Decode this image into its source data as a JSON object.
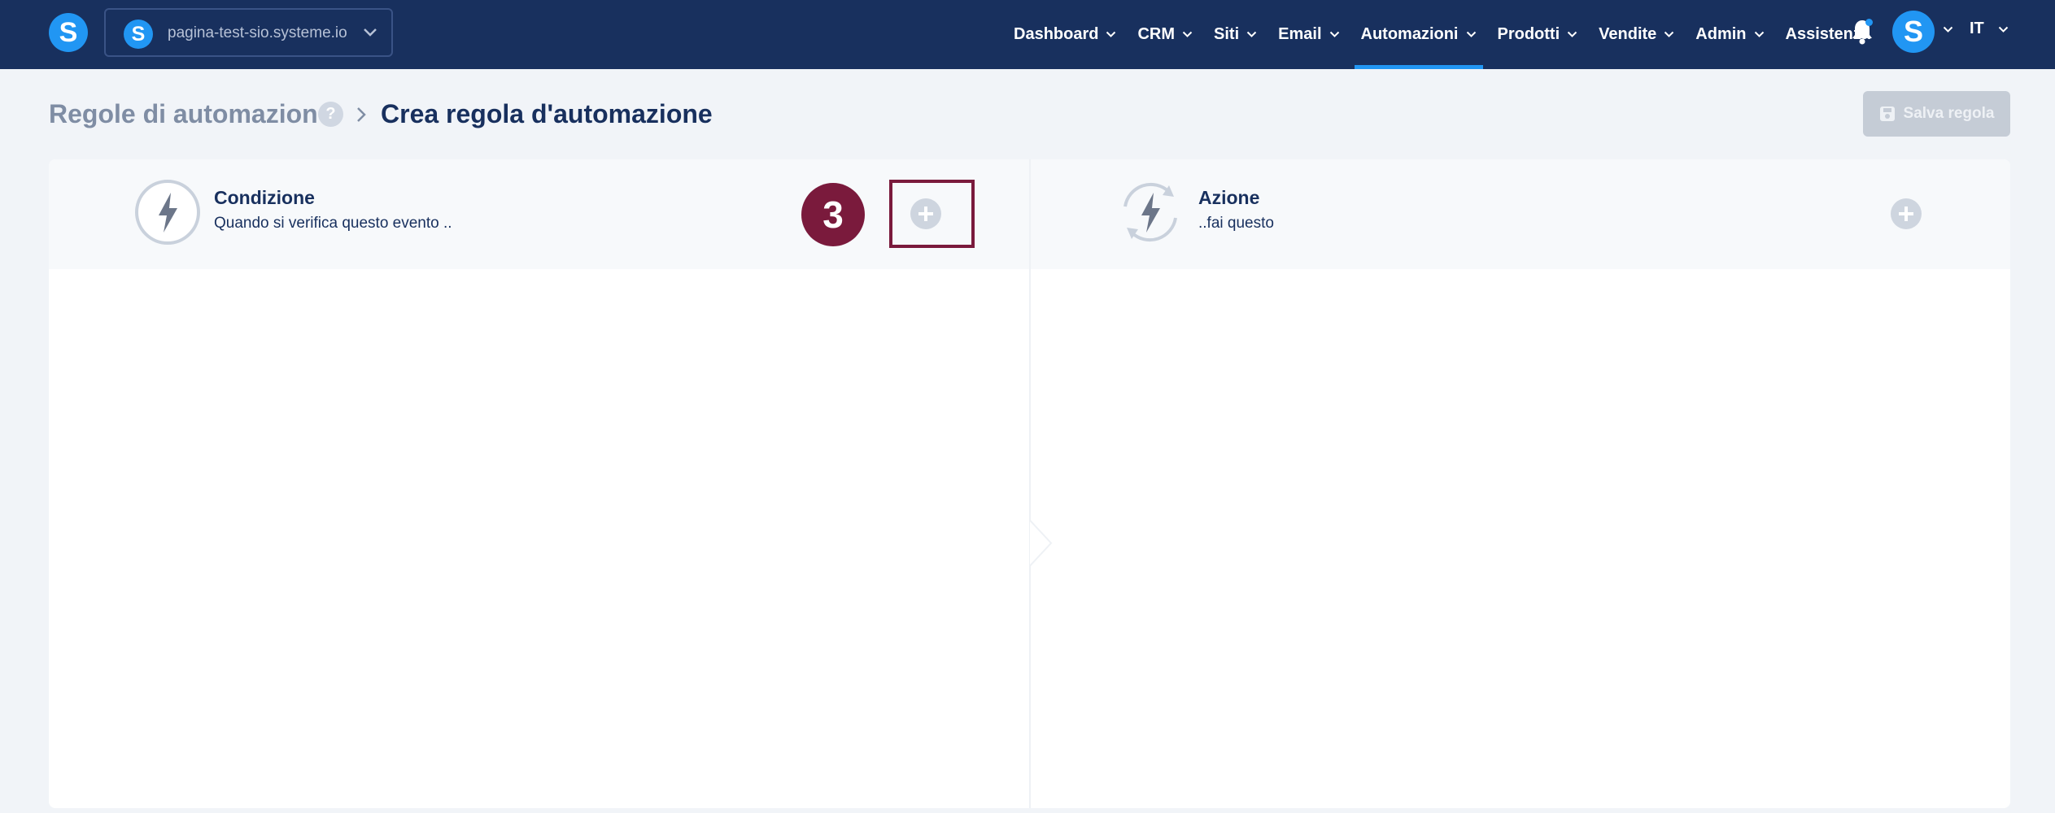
{
  "nav": {
    "site_name": "pagina-test-sio.systeme.io",
    "logo_letter": "S",
    "items": [
      {
        "label": "Dashboard",
        "active": false
      },
      {
        "label": "CRM",
        "active": false
      },
      {
        "label": "Siti",
        "active": false
      },
      {
        "label": "Email",
        "active": false
      },
      {
        "label": "Automazioni",
        "active": true
      },
      {
        "label": "Prodotti",
        "active": false
      },
      {
        "label": "Vendite",
        "active": false
      },
      {
        "label": "Admin",
        "active": false
      }
    ],
    "support": "Assistenza",
    "avatar_letter": "S",
    "language": "IT"
  },
  "header": {
    "breadcrumb_parent": "Regole di automazione",
    "help_symbol": "?",
    "title": "Crea regola d'automazione",
    "save_label": "Salva regola"
  },
  "rule": {
    "condition": {
      "title": "Condizione",
      "subtitle": "Quando si verifica questo evento .."
    },
    "action": {
      "title": "Azione",
      "subtitle": "..fai questo"
    }
  },
  "annotation": {
    "step_number": "3"
  },
  "colors": {
    "navbar": "#18305e",
    "accent": "#2196f3",
    "annotation": "#7a1a3c"
  }
}
